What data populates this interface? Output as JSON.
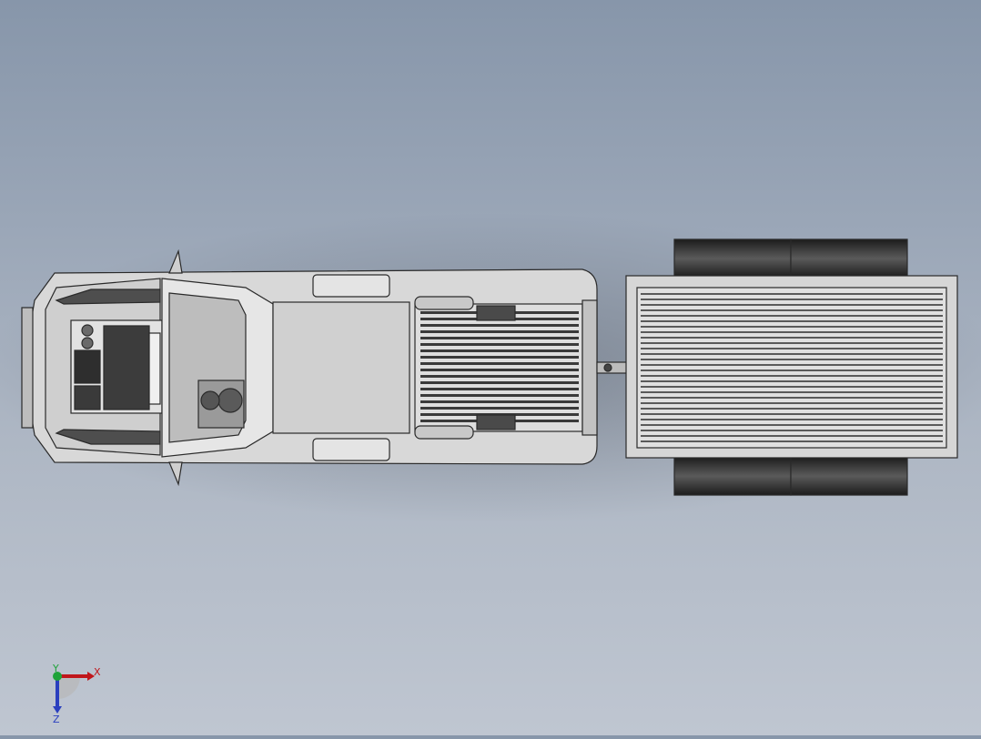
{
  "view": {
    "background_top": "#8796aa",
    "background_bottom": "#bfc6d1",
    "model_fill": "#d4d4d4",
    "model_edge": "#2a2a2a",
    "tire_color": "#2b2b2b"
  },
  "triad": {
    "x_label": "X",
    "y_label": "Y",
    "z_label": "Z",
    "x_color": "#c0161b",
    "y_color": "#1fa33a",
    "z_color": "#2a3fbf"
  }
}
